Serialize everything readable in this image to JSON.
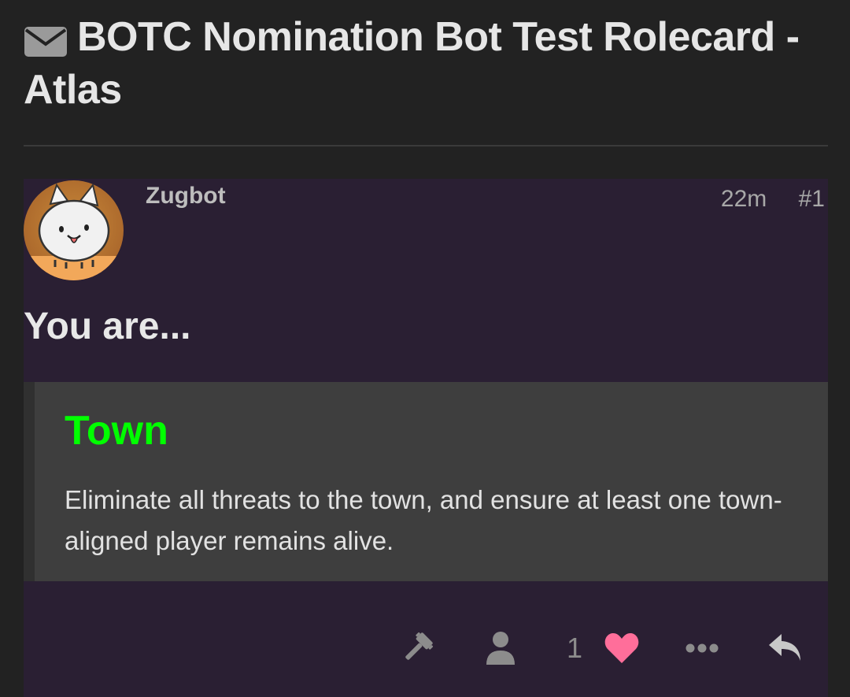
{
  "topic": {
    "title": "BOTC Nomination Bot Test Rolecard - Atlas",
    "icon": "envelope-icon"
  },
  "post": {
    "author": "Zugbot",
    "time": "22m",
    "number": "#1",
    "lead": "You are...",
    "role": {
      "name": "Town",
      "color": "#00ff00",
      "description": "Eliminate all threats to the town, and ensure at least one town-aligned player remains alive."
    },
    "actions": {
      "like_count": "1",
      "icons": [
        "gavel-icon",
        "user-icon",
        "heart-icon",
        "ellipsis-icon",
        "reply-icon"
      ]
    }
  },
  "colors": {
    "page_background": "#222222",
    "post_background": "#2a1f33",
    "quote_background": "#3e3e3e",
    "heart": "#ff6e9a"
  }
}
